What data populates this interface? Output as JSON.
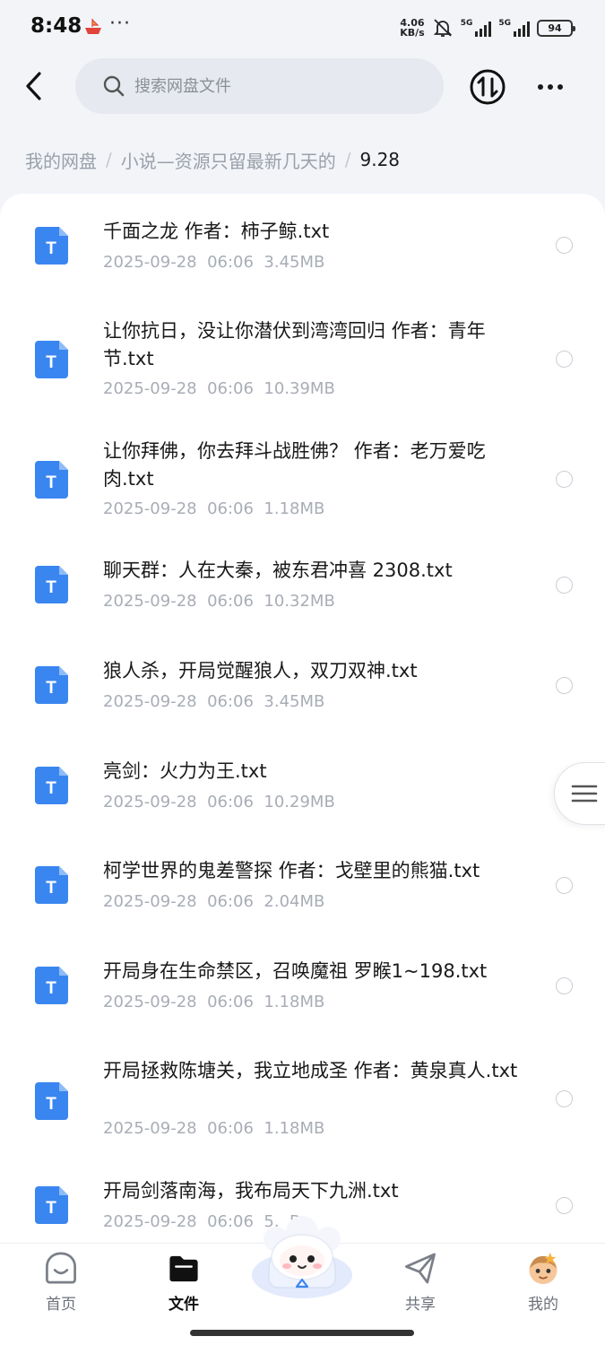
{
  "status_bar": {
    "time": "8:48",
    "more": "···",
    "net_speed_value": "4.06",
    "net_speed_unit": "KB/s",
    "signal_label": "5G",
    "battery": "94"
  },
  "header": {
    "search_placeholder": "搜索网盘文件",
    "icons": {
      "back": "back-arrow-icon",
      "search": "search-icon",
      "transfer": "transfer-icon",
      "more": "more-dots-icon"
    }
  },
  "breadcrumb": {
    "items": [
      "我的网盘",
      "小说—资源只留最新几天的",
      "9.28"
    ],
    "separator": "/"
  },
  "files": [
    {
      "name": "千面之龙 作者：柿子鲸.txt",
      "date": "2025-09-28",
      "time": "06:06",
      "size": "3.45MB"
    },
    {
      "name": "让你抗日，没让你潜伏到湾湾回归 作者：青年节.txt",
      "date": "2025-09-28",
      "time": "06:06",
      "size": "10.39MB"
    },
    {
      "name": "让你拜佛，你去拜斗战胜佛？ 作者：老万爱吃肉.txt",
      "date": "2025-09-28",
      "time": "06:06",
      "size": "1.18MB"
    },
    {
      "name": "聊天群：人在大秦，被东君冲喜 2308.txt",
      "date": "2025-09-28",
      "time": "06:06",
      "size": "10.32MB"
    },
    {
      "name": "狼人杀，开局觉醒狼人，双刀双神.txt",
      "date": "2025-09-28",
      "time": "06:06",
      "size": "3.45MB"
    },
    {
      "name": "亮剑：火力为王.txt",
      "date": "2025-09-28",
      "time": "06:06",
      "size": "10.29MB"
    },
    {
      "name": "柯学世界的鬼差警探 作者：戈壁里的熊猫.txt",
      "date": "2025-09-28",
      "time": "06:06",
      "size": "2.04MB"
    },
    {
      "name": "开局身在生命禁区，召唤魔祖 罗睺1~198.txt",
      "date": "2025-09-28",
      "time": "06:06",
      "size": "1.18MB"
    },
    {
      "name": "开局拯救陈塘关，我立地成圣 作者：黄泉真人.txt",
      "date": "2025-09-28",
      "time": "06:06",
      "size": "1.18MB"
    },
    {
      "name": "开局剑落南海，我布局天下九洲.txt",
      "date": "2025-09-28",
      "time": "06:06",
      "size": "5.  B"
    }
  ],
  "file_icon_letter": "T",
  "bottom_nav": {
    "items": [
      {
        "label": "首页",
        "icon": "home-icon"
      },
      {
        "label": "文件",
        "icon": "folder-icon"
      },
      {
        "label": "共享",
        "icon": "share-icon"
      },
      {
        "label": "我的",
        "icon": "profile-avatar-icon"
      }
    ],
    "active": "文件",
    "center_icon": "ai-assistant-mascot-icon"
  },
  "colors": {
    "accent": "#3a86f0",
    "background": "#f2f4f8",
    "text_primary": "#1a1a1a",
    "text_secondary": "#a8adb6"
  }
}
